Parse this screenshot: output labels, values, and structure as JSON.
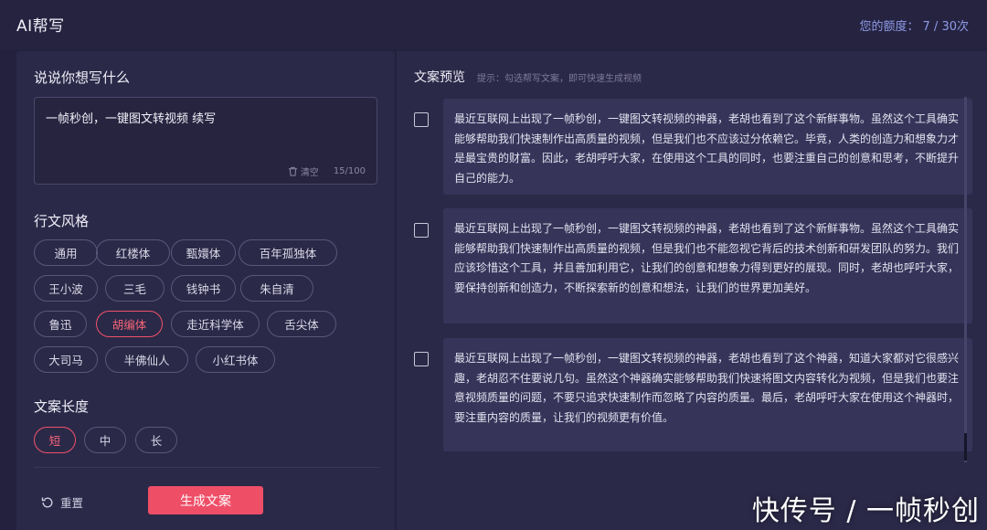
{
  "app": {
    "title": "AI帮写"
  },
  "quota": {
    "label": "您的额度：",
    "value": "7 / 30次"
  },
  "input_section": {
    "title": "说说你想写什么",
    "value": "一帧秒创，一键图文转视频 续写",
    "clear_label": "清空",
    "counter": "15/100"
  },
  "style_section": {
    "title": "行文风格",
    "options": [
      "通用",
      "红楼体",
      "甄嬛体",
      "百年孤独体",
      "王小波",
      "三毛",
      "钱钟书",
      "朱自清",
      "鲁迅",
      "胡编体",
      "走近科学体",
      "舌尖体",
      "大司马",
      "半佛仙人",
      "小红书体"
    ],
    "selected": "胡编体"
  },
  "length_section": {
    "title": "文案长度",
    "options": [
      "短",
      "中",
      "长"
    ],
    "selected": "短"
  },
  "actions": {
    "reset_label": "重置",
    "generate_label": "生成文案"
  },
  "preview": {
    "title": "文案预览",
    "hint": "提示：勾选帮写文案，即可快速生成视频",
    "cards": [
      {
        "checked": false,
        "text": "最近互联网上出现了一帧秒创，一键图文转视频的神器，老胡也看到了这个新鲜事物。虽然这个工具确实能够帮助我们快速制作出高质量的视频，但是我们也不应该过分依赖它。毕竟，人类的创造力和想象力才是最宝贵的财富。因此，老胡呼吁大家，在使用这个工具的同时，也要注重自己的创意和思考，不断提升自己的能力。"
      },
      {
        "checked": false,
        "text": "最近互联网上出现了一帧秒创，一键图文转视频的神器，老胡也看到了这个新鲜事物。虽然这个工具确实能够帮助我们快速制作出高质量的视频，但是我们也不能忽视它背后的技术创新和研发团队的努力。我们应该珍惜这个工具，并且善加利用它，让我们的创意和想象力得到更好的展现。同时，老胡也呼吁大家，要保持创新和创造力，不断探索新的创意和想法，让我们的世界更加美好。"
      },
      {
        "checked": false,
        "text": "最近互联网上出现了一帧秒创，一键图文转视频的神器，老胡也看到了这个神器，知道大家都对它很感兴趣，老胡忍不住要说几句。虽然这个神器确实能够帮助我们快速将图文内容转化为视频，但是我们也要注意视频质量的问题，不要只追求快速制作而忽略了内容的质量。最后，老胡呼吁大家在使用这个神器时，要注重内容的质量，让我们的视频更有价值。"
      }
    ]
  },
  "watermark": "快传号 / 一帧秒创"
}
